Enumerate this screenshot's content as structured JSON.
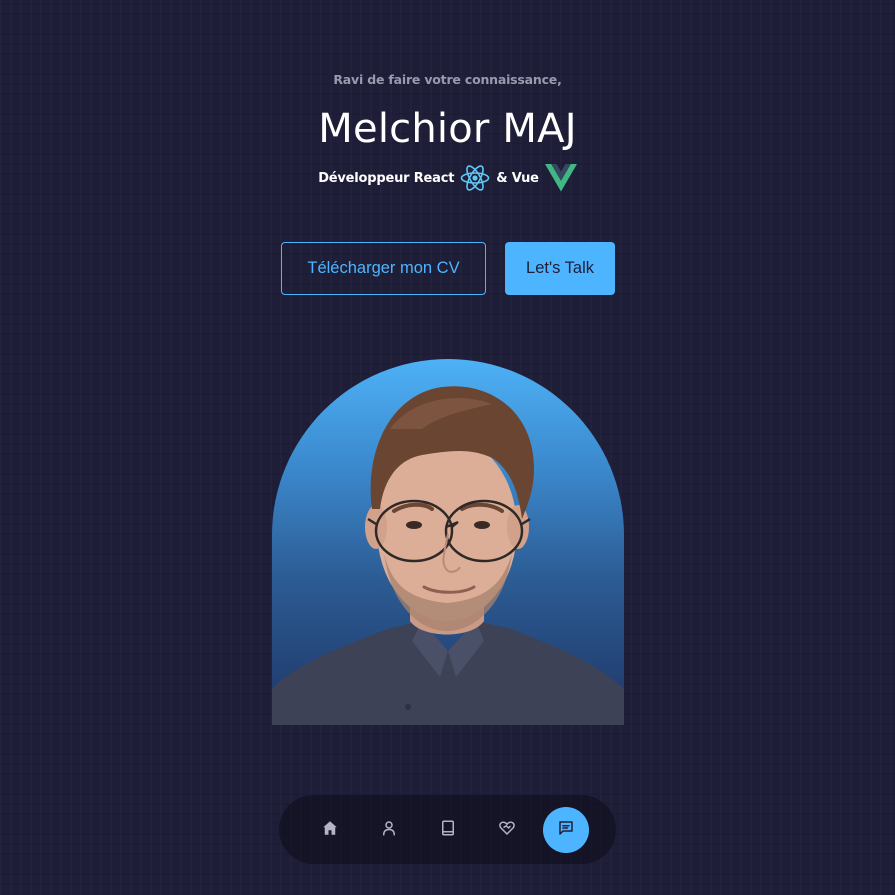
{
  "header": {
    "greeting": "Ravi de faire votre connaissance,",
    "name": "Melchior MAJ",
    "role_prefix": "Développeur React",
    "role_suffix": "& Vue"
  },
  "actions": {
    "download_cv_label": "Télécharger mon CV",
    "talk_label": "Let's Talk"
  },
  "nav": {
    "items": [
      {
        "icon": "home-icon",
        "active": false
      },
      {
        "icon": "user-icon",
        "active": false
      },
      {
        "icon": "book-icon",
        "active": false
      },
      {
        "icon": "heart-handshake-icon",
        "active": false
      },
      {
        "icon": "message-icon",
        "active": true
      }
    ]
  },
  "colors": {
    "background": "#1f1e38",
    "accent": "#4db5ff",
    "text": "#ffffff",
    "muted": "#9a9aae",
    "react": "#5fc8f5",
    "vue_green": "#41b883",
    "vue_dark": "#34495e"
  }
}
